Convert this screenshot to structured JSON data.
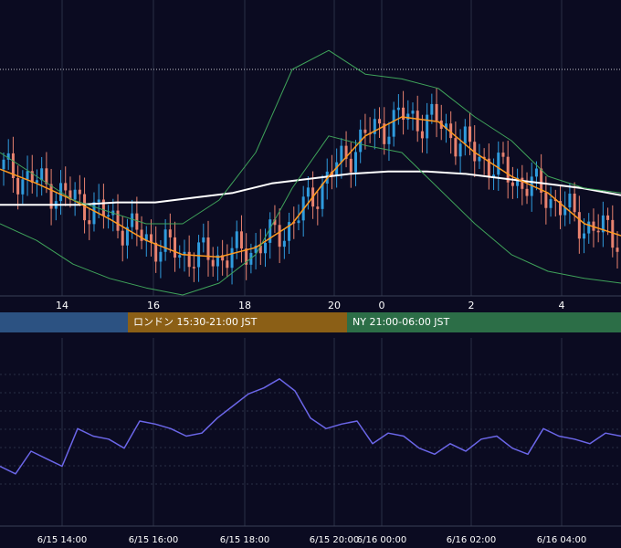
{
  "colors": {
    "background": "#0b0b21",
    "grid": "#2a2f45",
    "candle_up": "#2f9bdd",
    "candle_down": "#e8826f",
    "moving_average_long": "#ffffff",
    "moving_average_short": "#ff9a1f",
    "bollinger_band": "#3fa35a",
    "oscillator": "#6b66e8",
    "session_tokyo": "#2c5282",
    "session_london": "#8b5f16",
    "session_ny": "#2c6e47",
    "axis_text": "#ffffff"
  },
  "sessions": [
    {
      "label": "",
      "color": "#2c5282"
    },
    {
      "label": "ロンドン 15:30-21:00 JST",
      "color": "#8b5f16"
    },
    {
      "label": "NY 21:00-06:00 JST",
      "color": "#2c6e47"
    }
  ],
  "chart_data": [
    {
      "type": "candlestick",
      "x_ticks": [
        "14",
        "16",
        "18",
        "20",
        "0",
        "2",
        "4"
      ],
      "grid": true,
      "series": [
        {
          "kind": "candlestick"
        },
        {
          "kind": "moving-average-long",
          "values": [
            0.33,
            0.33,
            0.33,
            0.34,
            0.34,
            0.36,
            0.38,
            0.42,
            0.44,
            0.46,
            0.47,
            0.47,
            0.46,
            0.44,
            0.42,
            0.4,
            0.37
          ]
        },
        {
          "kind": "moving-average-short",
          "values": [
            0.48,
            0.42,
            0.35,
            0.27,
            0.18,
            0.12,
            0.11,
            0.15,
            0.25,
            0.45,
            0.62,
            0.7,
            0.68,
            0.55,
            0.45,
            0.38,
            0.25,
            0.2
          ]
        },
        {
          "kind": "bollinger-upper",
          "values": [
            0.55,
            0.45,
            0.35,
            0.3,
            0.25,
            0.25,
            0.35,
            0.55,
            0.9,
            0.98,
            0.88,
            0.86,
            0.82,
            0.7,
            0.6,
            0.45,
            0.4,
            0.38
          ]
        },
        {
          "kind": "bollinger-lower",
          "values": [
            0.25,
            0.18,
            0.08,
            0.02,
            -0.02,
            -0.05,
            0.0,
            0.12,
            0.4,
            0.62,
            0.58,
            0.55,
            0.4,
            0.25,
            0.12,
            0.05,
            0.02,
            0.0
          ]
        }
      ]
    },
    {
      "type": "line",
      "x_ticks": [
        "6/15 14:00",
        "6/15 16:00",
        "6/15 18:00",
        "6/15 20:00",
        "6/16 00:00",
        "6/16 02:00",
        "6/16 04:00"
      ],
      "grid": true,
      "series": [
        {
          "kind": "oscillator",
          "values": [
            0.3,
            0.25,
            0.4,
            0.35,
            0.3,
            0.55,
            0.5,
            0.48,
            0.42,
            0.6,
            0.58,
            0.55,
            0.5,
            0.52,
            0.62,
            0.7,
            0.78,
            0.82,
            0.88,
            0.8,
            0.62,
            0.55,
            0.58,
            0.6,
            0.45,
            0.52,
            0.5,
            0.42,
            0.38,
            0.45,
            0.4,
            0.48,
            0.5,
            0.42,
            0.38,
            0.55,
            0.5,
            0.48,
            0.45,
            0.52,
            0.5
          ]
        }
      ]
    }
  ]
}
